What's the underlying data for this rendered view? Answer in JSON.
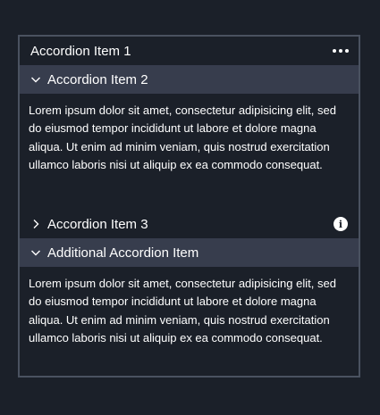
{
  "panel": {
    "title": "Accordion Item 1",
    "menu_icon": "more-horizontal-icon"
  },
  "accordion": [
    {
      "label": "Accordion Item 2",
      "expanded": true,
      "body": "Lorem ipsum dolor sit amet, consectetur adipisicing elit, sed do eiusmod tempor incididunt ut labore et dolore magna aliqua. Ut enim ad minim veniam, quis nostrud exercitation ullamco laboris nisi ut aliquip ex ea commodo consequat."
    },
    {
      "label": "Accordion Item 3",
      "expanded": false,
      "info_icon": "info-icon",
      "info_glyph": "i"
    },
    {
      "label": "Additional Accordion Item",
      "expanded": true,
      "body": "Lorem ipsum dolor sit amet, consectetur adipisicing elit, sed do eiusmod tempor incididunt ut labore et dolore magna aliqua. Ut enim ad minim veniam, quis nostrud exercitation ullamco laboris nisi ut aliquip ex ea commodo consequat."
    }
  ],
  "colors": {
    "background": "#1b2029",
    "border": "#4a5260",
    "expanded_header": "#373d4d",
    "text": "#ffffff"
  }
}
